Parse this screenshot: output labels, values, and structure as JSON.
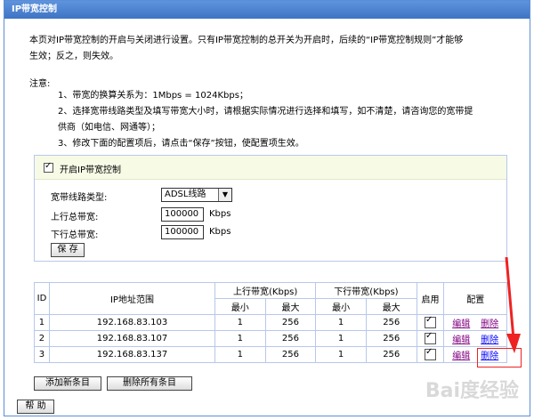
{
  "header": {
    "title": "IP带宽控制"
  },
  "intro": {
    "line1": "本页对IP带宽控制的开启与关闭进行设置。只有IP带宽控制的总开关为开启时，后续的“IP带宽控制规则”才能够",
    "line2": "生效；反之，则失效。"
  },
  "notes": {
    "label": "注意:",
    "items": [
      "1、带宽的换算关系为：1Mbps = 1024Kbps；",
      "2、选择宽带线路类型及填写带宽大小时，请根据实际情况进行选择和填写，如不清楚，请咨询您的宽带提",
      "供商（如电信、网通等）；",
      "3、修改下面的配置项后，请点击“保存”按钮，使配置项生效。"
    ]
  },
  "settings": {
    "enable_label": "开启IP带宽控制",
    "line_type_label": "宽带线路类型:",
    "line_type_value": "ADSL线路",
    "up_label": "上行总带宽:",
    "up_value": "100000",
    "down_label": "下行总带宽:",
    "down_value": "100000",
    "unit": "Kbps",
    "save_label": "保 存"
  },
  "table": {
    "headers": {
      "id": "ID",
      "ip_range": "IP地址范围",
      "up": "上行带宽(Kbps)",
      "down": "下行带宽(Kbps)",
      "enable": "启用",
      "config": "配置",
      "min": "最小",
      "max": "最大"
    },
    "rows": [
      {
        "id": "1",
        "ip": "192.168.83.103",
        "up_min": "1",
        "up_max": "256",
        "down_min": "1",
        "down_max": "256",
        "edit": "编辑",
        "delete": "删除"
      },
      {
        "id": "2",
        "ip": "192.168.83.107",
        "up_min": "1",
        "up_max": "256",
        "down_min": "1",
        "down_max": "256",
        "edit": "编辑",
        "delete": "删除"
      },
      {
        "id": "3",
        "ip": "192.168.83.137",
        "up_min": "1",
        "up_max": "256",
        "down_min": "1",
        "down_max": "256",
        "edit": "编辑",
        "delete": "删除"
      }
    ]
  },
  "actions": {
    "add_label": "添加新条目",
    "delete_all_label": "删除所有条目",
    "help_label": "帮 助"
  },
  "watermark": "Bai度经验",
  "colors": {
    "title_bar": "#4a80cf",
    "highlight": "#e22222",
    "link_visited": "#800080"
  }
}
